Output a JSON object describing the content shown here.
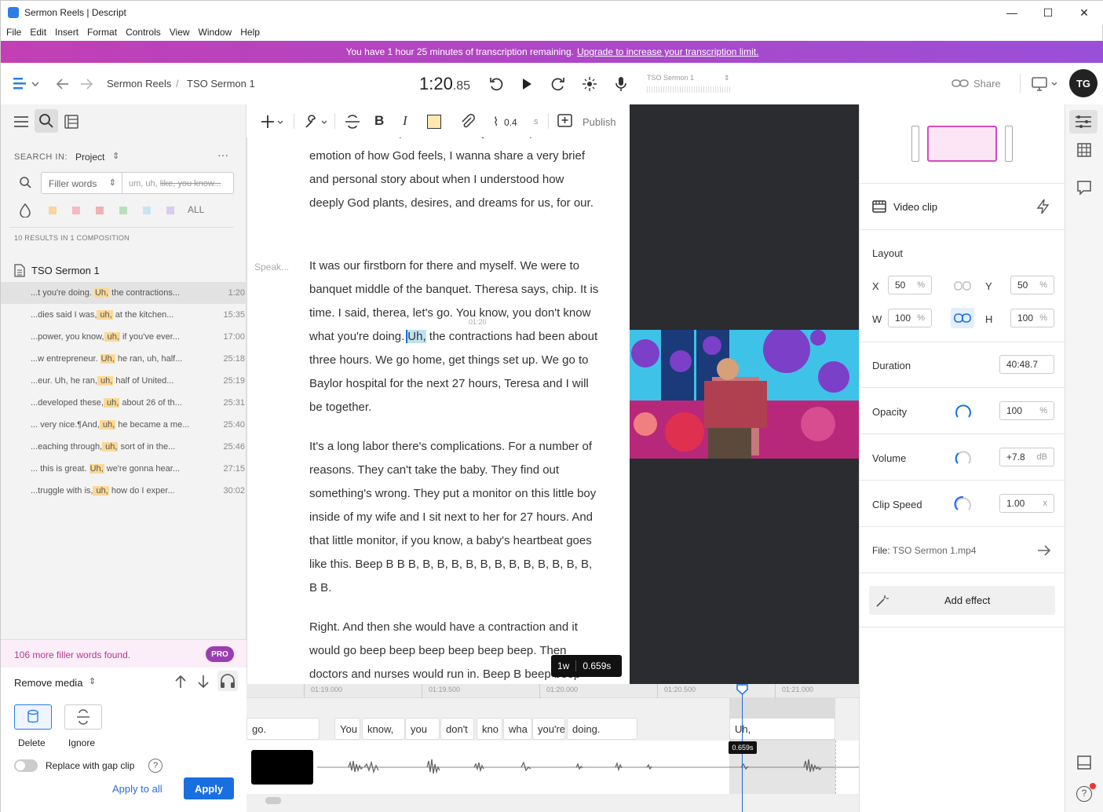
{
  "window": {
    "title": "Sermon Reels | Descript",
    "min": "—",
    "max": "☐",
    "close": "✕"
  },
  "menu": [
    "File",
    "Edit",
    "Insert",
    "Format",
    "Controls",
    "View",
    "Window",
    "Help"
  ],
  "banner": {
    "text": "You have 1 hour 25 minutes of transcription remaining.",
    "link": "Upgrade to increase your transcription limit."
  },
  "toolbar": {
    "breadcrumb_project": "Sermon Reels",
    "breadcrumb_sep": "/",
    "breadcrumb_comp": "TSO Sermon 1",
    "timecode_main": "1:20",
    "timecode_frac": ".85",
    "track_name": "TSO Sermon 1",
    "share": "Share",
    "avatar": "TG"
  },
  "editor_toolbar": {
    "speed_value": "0.4",
    "speed_unit": "s",
    "publish": "Publish"
  },
  "search": {
    "label": "SEARCH IN:",
    "scope": "Project",
    "filter": "Filler words",
    "placeholder": "um, uh, ",
    "placeholder_strike": "like, you know...",
    "all": "ALL",
    "results_summary": "10 RESULTS IN 1 COMPOSITION",
    "composition": "TSO Sermon 1",
    "swatch_colors": [
      "#f7d6a0",
      "#f5b8c4",
      "#f2b0b0",
      "#b8e0b8",
      "#c8e4f5",
      "#d8ccf0"
    ],
    "results": [
      {
        "pre": "...t you're doing. ",
        "hit": "Uh,",
        "post": " the contractions...",
        "time": "1:20"
      },
      {
        "pre": "...dies said I was,",
        "hit": " uh,",
        "post": " at the kitchen...",
        "time": "15:35"
      },
      {
        "pre": "...power, you know,",
        "hit": " uh,",
        "post": " if you've ever...",
        "time": "17:00"
      },
      {
        "pre": "...w entrepreneur. ",
        "hit": "Uh,",
        "post": " he ran, uh, half...",
        "time": "25:18"
      },
      {
        "pre": "...eur. Uh, he ran,",
        "hit": " uh,",
        "post": " half of United...",
        "time": "25:19"
      },
      {
        "pre": "...developed these,",
        "hit": " uh,",
        "post": " about 26 of th...",
        "time": "25:31"
      },
      {
        "pre": "... very nice.¶And,",
        "hit": " uh,",
        "post": " he became a me...",
        "time": "25:40"
      },
      {
        "pre": "...eaching through,",
        "hit": " uh,",
        "post": " sort of in the...",
        "time": "25:46"
      },
      {
        "pre": "... this is great. ",
        "hit": "Uh,",
        "post": " we're gonna hear...",
        "time": "27:15"
      },
      {
        "pre": "...truggle with is,",
        "hit": " uh,",
        "post": " how do I exper...",
        "time": "30:02"
      }
    ]
  },
  "filler_panel": {
    "more": "106 more filler words found.",
    "pro": "PRO",
    "action": "Remove media",
    "delete": "Delete",
    "ignore": "Ignore",
    "gap": "Replace with gap clip",
    "apply_all": "Apply to all",
    "apply": "Apply"
  },
  "transcript": {
    "p1": "standard to live up to. And so for you to capture the emotion of how God feels, I wanna share a very brief and personal story about when I understood how deeply God plants, desires, and dreams for us, for our.",
    "speaker": "Speak...",
    "p2_before": "It was our firstborn for there and myself. We were to banquet middle of the banquet. Theresa says, chip. It is time. I said, therea, let's go. You know, you don't know what you're doing.",
    "p2_sel": "Uh,",
    "p2_after": " the contractions had been about three hours. We go home, get things set up. We go to Baylor hospital for the next 27 hours, Teresa and I will be together.",
    "p2_marker": "01:20",
    "p3": "It's a long labor there's complications. For a number of reasons. They can't take the baby. They find out something's wrong. They put a monitor on this little boy inside of my wife and I sit next to her for 27 hours. And that little monitor, if you know, a baby's heartbeat goes like this. Beep B B B, B, B, B, B, B, B, B, B, B, B, B, B, B B.",
    "p4": "Right. And then she would have a contraction and it would go beep beep beep beep beep beep. Then doctors and nurses would run in. Beep B beep beep",
    "tooltip_words": "1w",
    "tooltip_dur": "0.659s"
  },
  "right_panel": {
    "section": "Video clip",
    "layout": "Layout",
    "x_label": "X",
    "x": "50",
    "y_label": "Y",
    "y": "50",
    "w_label": "W",
    "w": "100",
    "h_label": "H",
    "h": "100",
    "pct": "%",
    "duration_label": "Duration",
    "duration": "40:48.7",
    "opacity_label": "Opacity",
    "opacity": "100",
    "volume_label": "Volume",
    "volume": "+7.8",
    "db": "dB",
    "speed_label": "Clip Speed",
    "speed": "1.00",
    "x_unit": "x",
    "file_label": "File:",
    "file": "TSO Sermon 1.mp4",
    "add_effect": "Add effect"
  },
  "timeline": {
    "ticks": [
      "01:19.000",
      "01:19.500",
      "01:20.000",
      "01:20.500",
      "01:21.000"
    ],
    "words": [
      "go.",
      "You",
      "know,",
      "you",
      "don't",
      "kno",
      "wha",
      "you're",
      "doing.",
      "Uh,"
    ],
    "playhead_label": "0.659s"
  }
}
